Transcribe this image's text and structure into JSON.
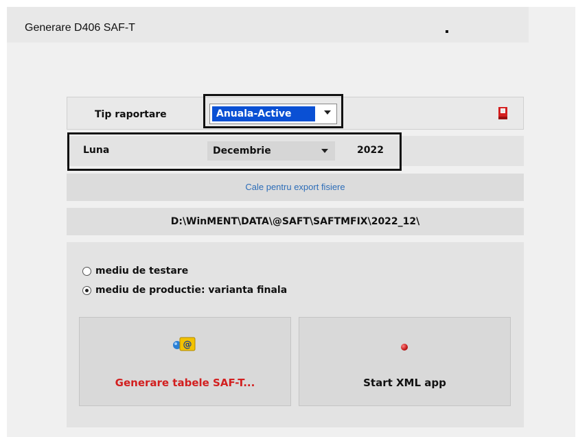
{
  "window": {
    "title": "Generare D406 SAF-T"
  },
  "tip_raportare": {
    "label": "Tip raportare",
    "value": "Anuala-Active"
  },
  "luna": {
    "label": "Luna",
    "month": "Decembrie",
    "year": "2022"
  },
  "export": {
    "caption": "Cale pentru export fisiere",
    "path": "D:\\WinMENT\\DATA\\@SAFT\\SAFTMFIX\\2022_12\\"
  },
  "environment": {
    "options": [
      {
        "label": "mediu de testare",
        "selected": false
      },
      {
        "label": "mediu de productie: varianta finala",
        "selected": true
      }
    ]
  },
  "actions": {
    "generate_label": "Generare tabele SAF-T...",
    "generate_icon": "email-at-icon",
    "xml_label": "Start XML app",
    "xml_icon": "red-led-icon"
  },
  "colors": {
    "selection": "#0a50d4",
    "generate_text": "#d21f1f",
    "caption_text": "#2d6db8"
  }
}
